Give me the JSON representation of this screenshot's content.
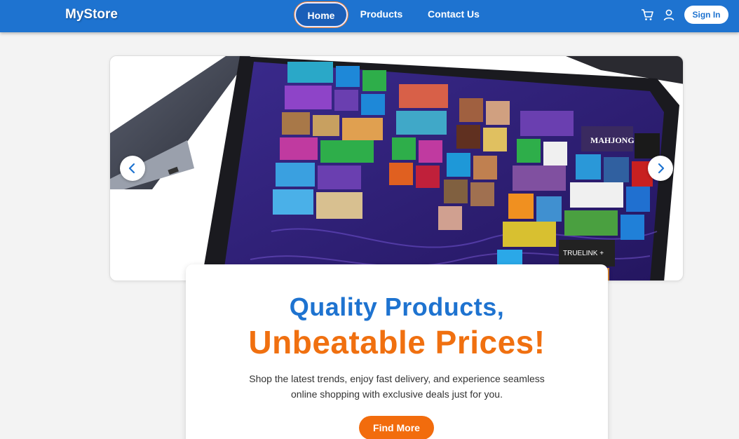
{
  "header": {
    "logo": "MyStore",
    "nav": [
      {
        "label": "Home",
        "active": true
      },
      {
        "label": "Products",
        "active": false
      },
      {
        "label": "Contact Us",
        "active": false
      }
    ],
    "icons": [
      "cart-icon",
      "user-icon"
    ],
    "signin_label": "Sign In"
  },
  "carousel": {
    "image": "laptop-with-tiled-start-screen",
    "prev_icon": "chevron-left-icon",
    "next_icon": "chevron-right-icon",
    "tile_texts": {
      "mahjong": "MAHJONG",
      "truelink": "TRUELINK +"
    }
  },
  "hero": {
    "title_line1": "Quality Products,",
    "title_line2": "Unbeatable Prices!",
    "description": "Shop the latest trends, enjoy fast delivery, and experience seamless online shopping with exclusive deals just for you.",
    "cta_label": "Find More"
  },
  "colors": {
    "header_bg": "#1e73d0",
    "accent_blue": "#1e73d0",
    "accent_orange": "#f26c0d",
    "page_bg": "#f3f3f3"
  }
}
